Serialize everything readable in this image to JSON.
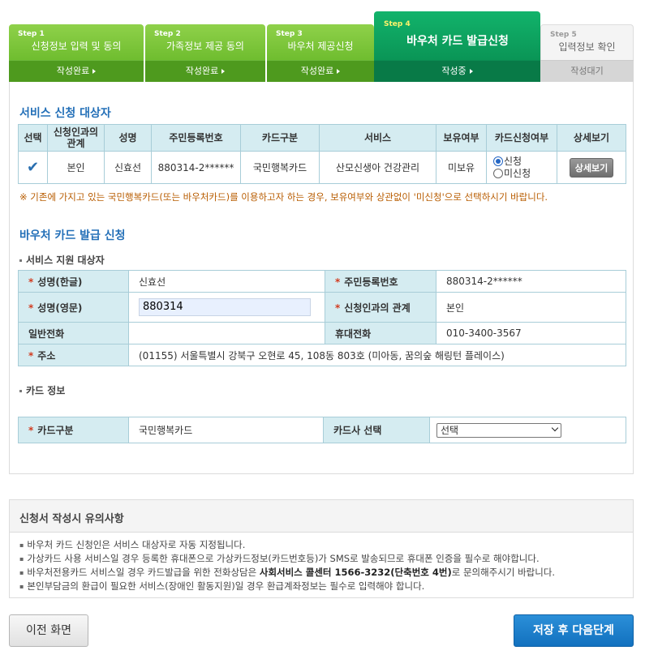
{
  "steps": [
    {
      "num": "Step 1",
      "label": "신청정보 입력 및 동의",
      "status": "작성완료"
    },
    {
      "num": "Step 2",
      "label": "가족정보 제공 동의",
      "status": "작성완료"
    },
    {
      "num": "Step 3",
      "label": "바우처 제공신청",
      "status": "작성완료"
    },
    {
      "num": "Step 4",
      "label": "바우처 카드 발급신청",
      "status": "작성중"
    },
    {
      "num": "Step 5",
      "label": "입력정보 확인",
      "status": "작성대기"
    }
  ],
  "applicants": {
    "title": "서비스 신청 대상자",
    "headers": [
      "선택",
      "신청인과의 관계",
      "성명",
      "주민등록번호",
      "카드구분",
      "서비스",
      "보유여부",
      "카드신청여부",
      "상세보기"
    ],
    "rows": [
      {
        "relation": "본인",
        "name": "신효선",
        "rrn": "880314-2******",
        "card_type": "국민행복카드",
        "service": "산모신생아 건강관리",
        "owned": "미보유",
        "apply_option": "신청",
        "not_apply_option": "미신청",
        "detail_label": "상세보기"
      }
    ],
    "notice": "※ 기존에 가지고 있는 국민행복카드(또는 바우처카드)를 이용하고자 하는 경우, 보유여부와 상관없이 '미신청'으로 선택하시기 바랍니다."
  },
  "issue": {
    "title": "바우처 카드 발급 신청",
    "target": {
      "title": "서비스 지원 대상자",
      "name_kr_label": "성명(한글)",
      "name_kr": "신효선",
      "rrn_label": "주민등록번호",
      "rrn": "880314-2******",
      "name_en_label": "성명(영문)",
      "name_en_value": "880314",
      "relation_label": "신청인과의 관계",
      "relation": "본인",
      "phone_label": "일반전화",
      "phone": "",
      "mobile_label": "휴대전화",
      "mobile": "010-3400-3567",
      "address_label": "주소",
      "address": "(01155) 서울특별시 강북구 오현로 45, 108동 803호 (미아동, 꿈의숲 해링턴 플레이스)"
    },
    "card": {
      "title": "카드 정보",
      "type_label": "카드구분",
      "type": "국민행복카드",
      "company_label": "카드사 선택",
      "company_selected": "선택"
    }
  },
  "caution": {
    "title": "신청서 작성시 유의사항",
    "items": [
      {
        "text": "바우처 카드 신청인은 서비스 대상자로 자동 지정됩니다."
      },
      {
        "text": "가상카드 사용 서비스일 경우 등록한 휴대폰으로 가상카드정보(카드번호등)가 SMS로 발송되므로 휴대폰 인증을 필수로 해야합니다."
      },
      {
        "before": "바우처전용카드 서비스일 경우 카드발급을 위한 전화상담은 ",
        "bold": "사회서비스 콜센터 1566-3232(단축번호 4번)",
        "after": "로 문의해주시기 바랍니다."
      },
      {
        "text": "본인부담금의 환급이 필요한 서비스(장애인 활동지원)일 경우 환급계좌정보는 필수로 입력해야 합니다."
      }
    ]
  },
  "buttons": {
    "prev": "이전 화면",
    "next": "저장 후 다음단계"
  }
}
